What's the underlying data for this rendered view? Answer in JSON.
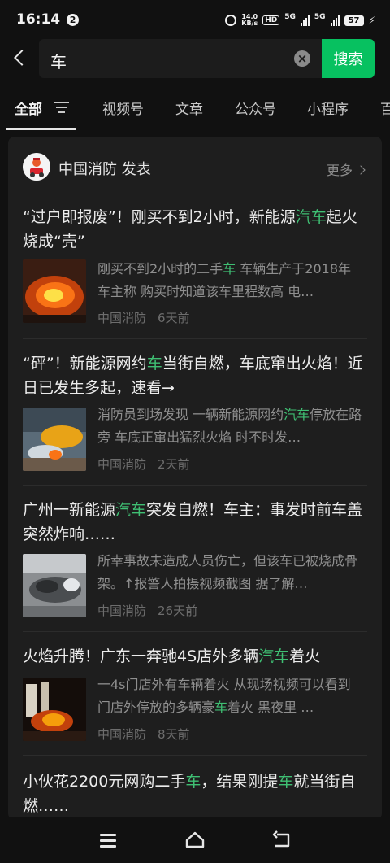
{
  "status": {
    "time": "16:14",
    "notif_count": "2",
    "net_speed_top": "14.0",
    "net_speed_bottom": "KB/s",
    "hd_label": "HD",
    "sig1_label": "5G",
    "sig2_label": "5G",
    "battery": "57"
  },
  "search": {
    "query": "车",
    "button_label": "搜索"
  },
  "tabs": [
    {
      "label": "全部"
    },
    {
      "label": "视频号"
    },
    {
      "label": "文章"
    },
    {
      "label": "公众号"
    },
    {
      "label": "小程序"
    },
    {
      "label": "百"
    }
  ],
  "source": {
    "name": "中国消防 发表",
    "more_label": "更多"
  },
  "articles": [
    {
      "title_parts": [
        "“过户即报废”！刚买不到2小时，新能源",
        "汽车",
        "起火烧成“壳”"
      ],
      "snippet_parts": [
        "刚买不到2小时的二手",
        "车",
        " 车辆生产于2018年 车主称 购买时知道该车里程数高 电…"
      ],
      "source": "中国消防",
      "time": "6天前"
    },
    {
      "title_parts": [
        "“砰”！新能源网约",
        "车",
        "当街自燃，车底窜出火焰！近日已发生多起，速看→"
      ],
      "snippet_parts": [
        "消防员到场发现 一辆新能源网约",
        "汽车",
        "停放在路旁 车底正窜出猛烈火焰 时不时发…"
      ],
      "source": "中国消防",
      "time": "2天前"
    },
    {
      "title_parts": [
        "广州一新能源",
        "汽车",
        "突发自燃！车主：事发时前车盖突然炸响……"
      ],
      "snippet_parts": [
        "所幸事故未造成人员伤亡，但该车已被烧成骨架。↑报警人拍摄视频截图 据了解…",
        "",
        ""
      ],
      "source": "中国消防",
      "time": "26天前"
    },
    {
      "title_parts": [
        "火焰升腾！广东一奔驰4S店外多辆",
        "汽车",
        "着火"
      ],
      "snippet_parts": [
        "一4s门店外有车辆着火 从现场视频可以看到 门店外停放的多辆豪",
        "车",
        "着火 黑夜里 …"
      ],
      "source": "中国消防",
      "time": "8天前"
    },
    {
      "title_parts": [
        "小伙花2200元网购二手",
        "车",
        "，结果刚提",
        "车",
        "就当街自燃……"
      ]
    }
  ],
  "colors": {
    "accent": "#07c160",
    "highlight": "#3fbf73",
    "background": "#111111",
    "card": "#1e1e1e"
  },
  "icons": {
    "back": "chevron-left-icon",
    "clear": "clear-icon",
    "filter": "filter-icon",
    "more": "chevron-right-icon",
    "nav_menu": "menu-icon",
    "nav_home": "home-icon",
    "nav_back": "back-icon"
  }
}
